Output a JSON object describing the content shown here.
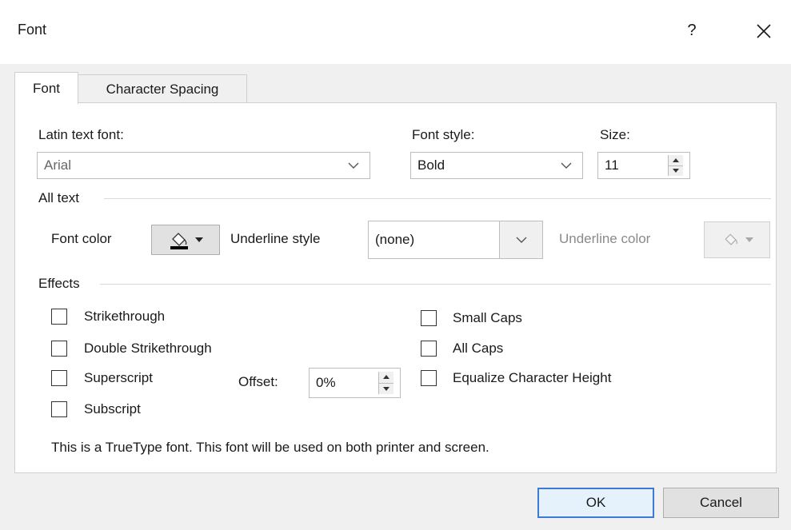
{
  "window": {
    "title": "Font",
    "help_label": "?",
    "close_label": "✕"
  },
  "tabs": [
    {
      "label": "Font",
      "active": true
    },
    {
      "label": "Character Spacing",
      "active": false
    }
  ],
  "latin_font": {
    "label": "Latin text font:",
    "value": "Arial"
  },
  "font_style": {
    "label": "Font style:",
    "value": "Bold"
  },
  "size": {
    "label": "Size:",
    "value": "11"
  },
  "all_text": {
    "heading": "All text",
    "font_color_label": "Font color",
    "underline_style_label": "Underline style",
    "underline_style_value": "(none)",
    "underline_color_label": "Underline color"
  },
  "effects": {
    "heading": "Effects",
    "strikethrough": {
      "label": "Strikethrough",
      "checked": false
    },
    "double_strikethrough": {
      "label": "Double Strikethrough",
      "checked": false
    },
    "superscript": {
      "label": "Superscript",
      "checked": false
    },
    "subscript": {
      "label": "Subscript",
      "checked": false
    },
    "offset_label": "Offset:",
    "offset_value": "0%",
    "small_caps": {
      "label": "Small Caps",
      "checked": false
    },
    "all_caps": {
      "label": "All Caps",
      "checked": false
    },
    "equalize_height": {
      "label": "Equalize Character Height",
      "checked": false
    }
  },
  "info_text": "This is a TrueType font. This font will be used on both printer and screen.",
  "buttons": {
    "ok": "OK",
    "cancel": "Cancel"
  },
  "colors": {
    "accent_border": "#3c7ad6",
    "font_color_swatch": "#000000"
  }
}
